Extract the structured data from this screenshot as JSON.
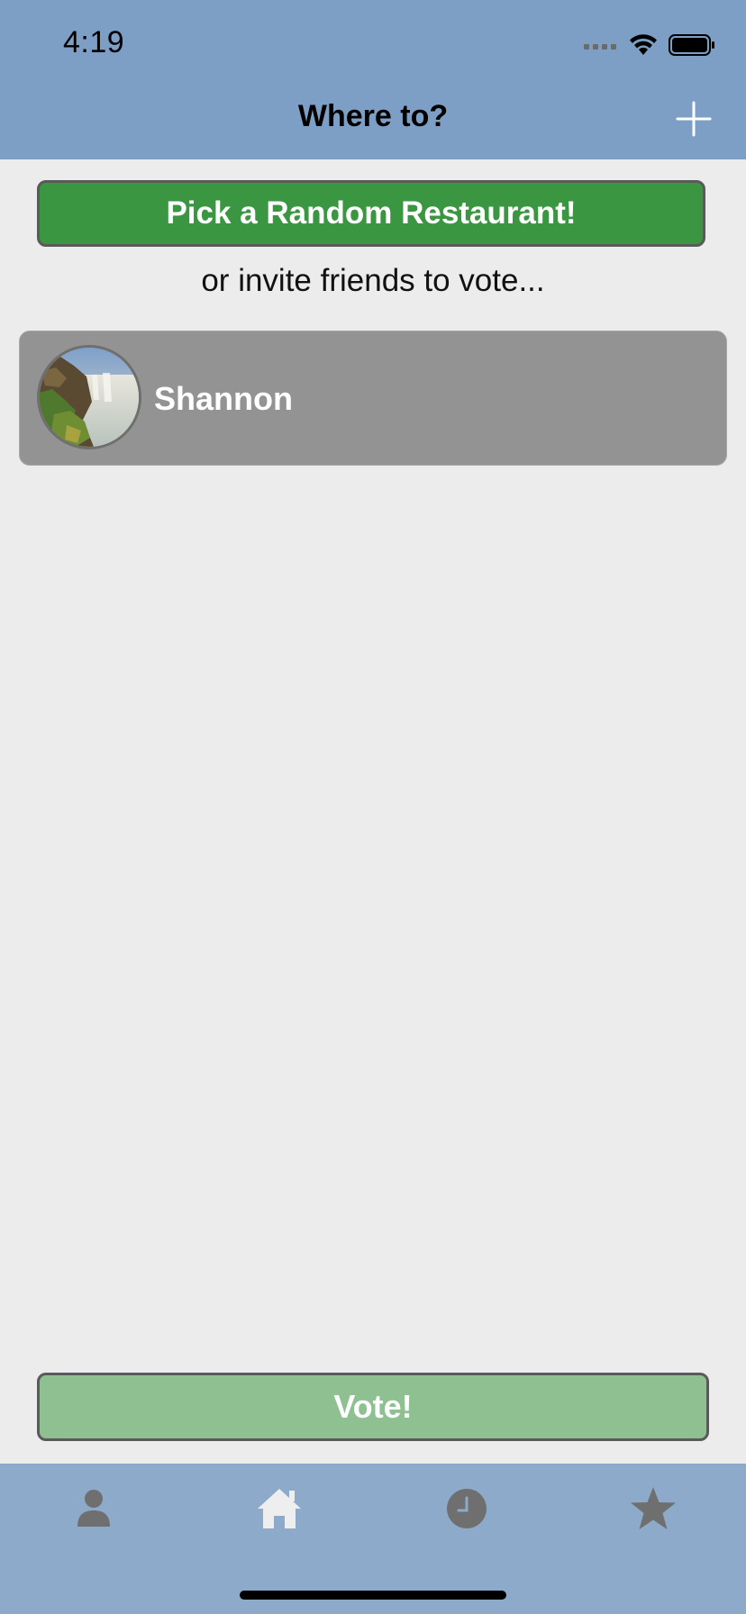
{
  "status_bar": {
    "time": "4:19"
  },
  "nav": {
    "title": "Where to?",
    "add_icon": "plus-icon"
  },
  "random_button": {
    "label": "Pick a Random Restaurant!"
  },
  "invite_text": "or invite friends to vote...",
  "friends": [
    {
      "name": "Shannon",
      "avatar": "waterfall-photo"
    }
  ],
  "vote_button": {
    "label": "Vote!"
  },
  "tabs": [
    {
      "icon": "person-icon"
    },
    {
      "icon": "home-icon"
    },
    {
      "icon": "clock-icon"
    },
    {
      "icon": "star-icon"
    }
  ],
  "colors": {
    "header": "#7d9fc5",
    "tabbar": "#8eaacb",
    "background": "#ececec",
    "primary_button": "#3a9641",
    "disabled_button": "#8fc092",
    "friend_row": "#939393"
  }
}
